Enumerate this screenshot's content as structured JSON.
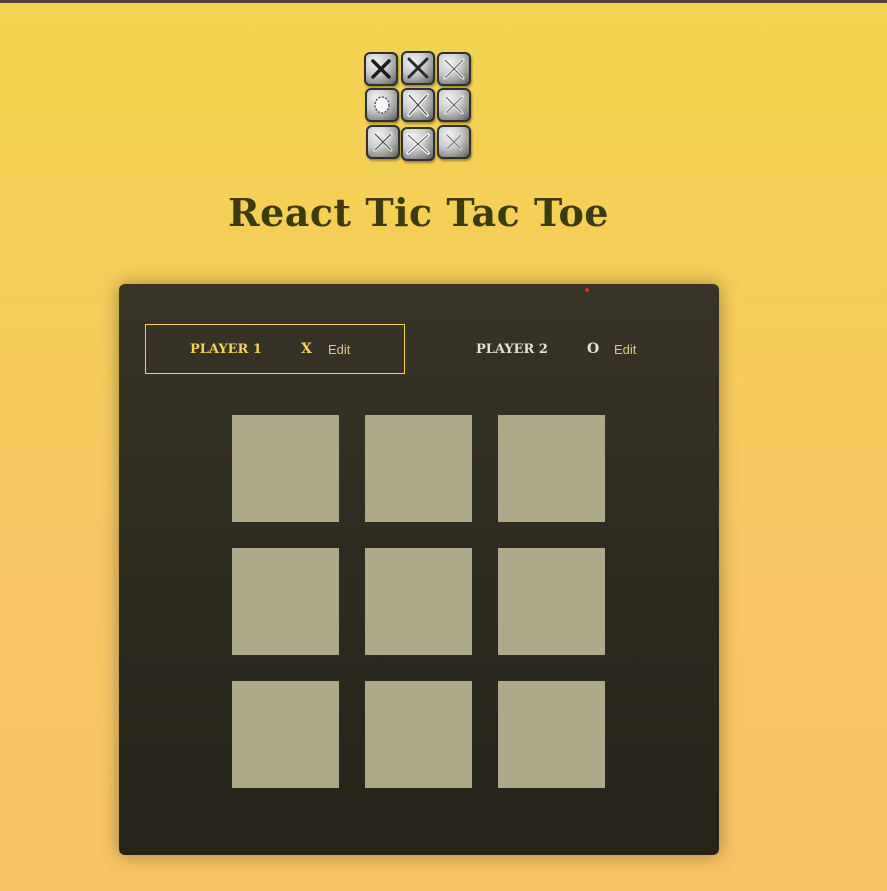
{
  "app": {
    "title": "React Tic Tac Toe"
  },
  "players": [
    {
      "name": "Player 1",
      "symbol": "X",
      "edit_label": "Edit",
      "active": true
    },
    {
      "name": "Player 2",
      "symbol": "O",
      "edit_label": "Edit",
      "active": false
    }
  ],
  "board": {
    "cells": [
      "",
      "",
      "",
      "",
      "",
      "",
      "",
      "",
      ""
    ]
  },
  "colors": {
    "accent": "#f6d15a",
    "panel": "#2c2a1f",
    "cell": "#aea989",
    "title": "#3d3b0e"
  },
  "icons": {
    "logo": "tic-tac-toe-logo-icon"
  }
}
